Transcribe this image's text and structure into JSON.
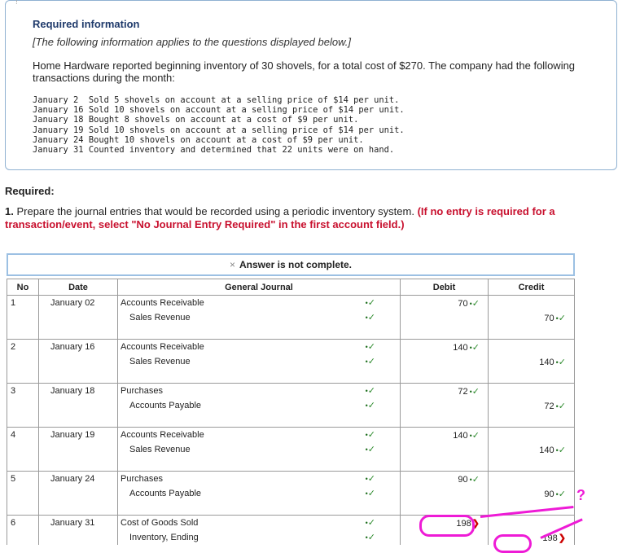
{
  "info": {
    "title": "Required information",
    "note": "[The following information applies to the questions displayed below.]",
    "body": "Home Hardware reported beginning inventory of 30 shovels, for a total cost of $270. The company had the following transactions during the month:",
    "transactions": [
      "January 2  Sold 5 shovels on account at a selling price of $14 per unit.",
      "January 16 Sold 10 shovels on account at a selling price of $14 per unit.",
      "January 18 Bought 8 shovels on account at a cost of $9 per unit.",
      "January 19 Sold 10 shovels on account at a selling price of $14 per unit.",
      "January 24 Bought 10 shovels on account at a cost of $9 per unit.",
      "January 31 Counted inventory and determined that 22 units were on hand."
    ]
  },
  "required_heading": "Required:",
  "question": {
    "number": "1.",
    "text": "Prepare the journal entries that would be recorded using a periodic inventory system.",
    "hint": "(If no entry is required for a transaction/event, select \"No Journal Entry Required\" in the first account field.)"
  },
  "banner": {
    "icon": "×",
    "text": "Answer is not complete."
  },
  "table": {
    "headers": {
      "no": "No",
      "date": "Date",
      "journal": "General Journal",
      "debit": "Debit",
      "credit": "Credit"
    },
    "entries": [
      {
        "no": "1",
        "date": "January 02",
        "debit_account": "Accounts Receivable",
        "credit_account": "Sales Revenue",
        "debit": "70",
        "credit": "70",
        "status": "correct"
      },
      {
        "no": "2",
        "date": "January 16",
        "debit_account": "Accounts Receivable",
        "credit_account": "Sales Revenue",
        "debit": "140",
        "credit": "140",
        "status": "correct"
      },
      {
        "no": "3",
        "date": "January 18",
        "debit_account": "Purchases",
        "credit_account": "Accounts Payable",
        "debit": "72",
        "credit": "72",
        "status": "correct"
      },
      {
        "no": "4",
        "date": "January 19",
        "debit_account": "Accounts Receivable",
        "credit_account": "Sales Revenue",
        "debit": "140",
        "credit": "140",
        "status": "correct"
      },
      {
        "no": "5",
        "date": "January 24",
        "debit_account": "Purchases",
        "credit_account": "Accounts Payable",
        "debit": "90",
        "credit": "90",
        "status": "correct"
      },
      {
        "no": "6",
        "date": "January 31",
        "debit_account": "Cost of Goods Sold",
        "credit_account": "Inventory, Ending",
        "debit": "198",
        "credit": "198",
        "status": "incorrect-amounts"
      }
    ]
  },
  "annotation": {
    "mark": "?",
    "color": "#ee1bd6"
  },
  "icons": {
    "correct": "check-icon",
    "incorrect": "cross-icon"
  }
}
